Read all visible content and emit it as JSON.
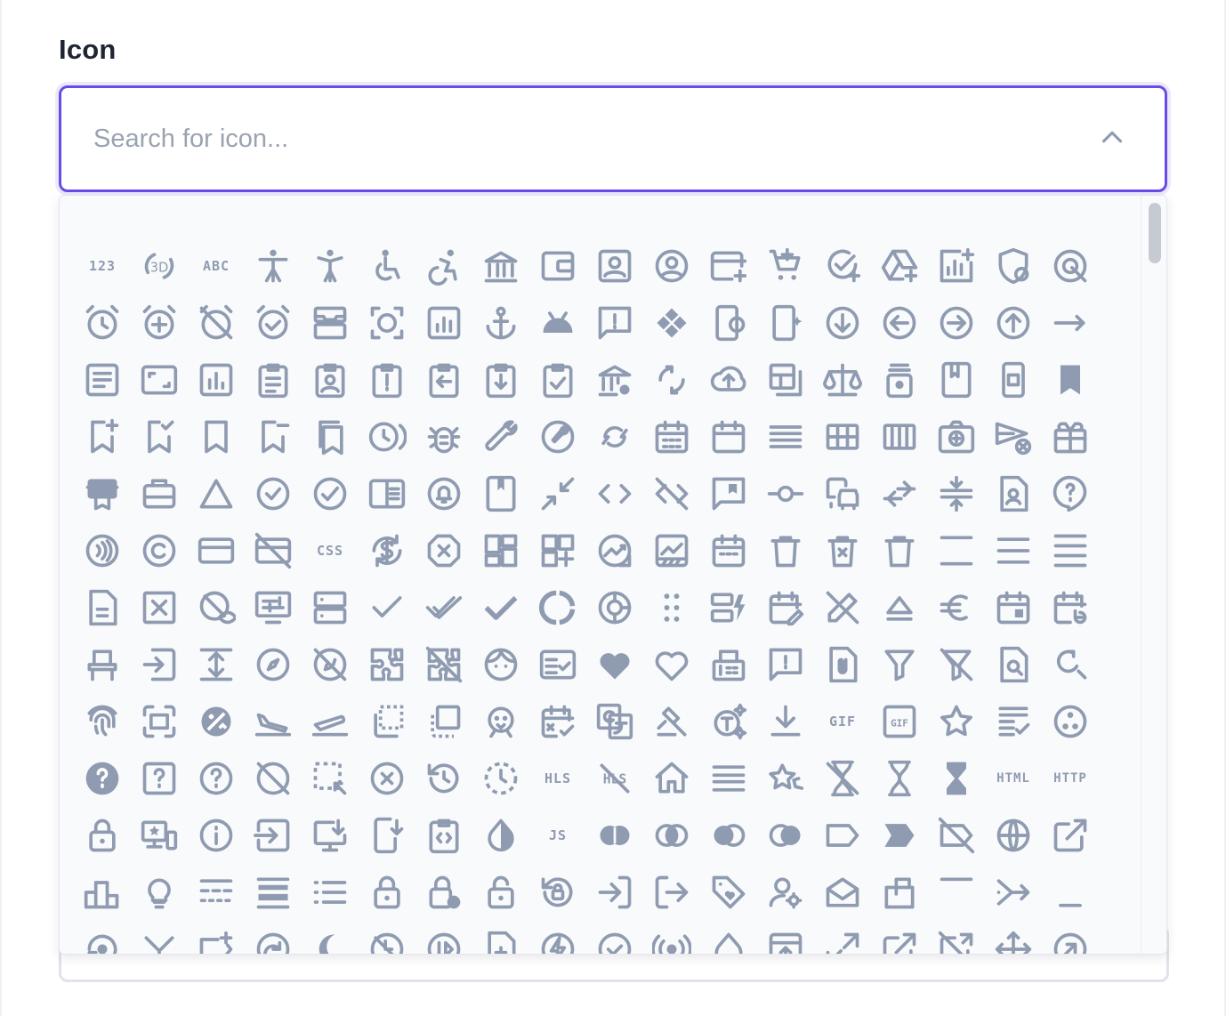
{
  "field": {
    "label": "Icon",
    "placeholder": "Search for icon...",
    "value": ""
  },
  "colors": {
    "accent": "#6a4be8",
    "icon": "#8f9bb0",
    "label": "#1f2533",
    "placeholder": "#9aa3b0"
  },
  "icons": [
    {
      "name": "123",
      "text": "123"
    },
    {
      "name": "3d-rotation",
      "text": ""
    },
    {
      "name": "abc",
      "text": "ABC"
    },
    {
      "name": "accessibility",
      "text": ""
    },
    {
      "name": "accessibility-new",
      "text": ""
    },
    {
      "name": "accessible",
      "text": ""
    },
    {
      "name": "accessible-forward",
      "text": ""
    },
    {
      "name": "account-balance",
      "text": ""
    },
    {
      "name": "account-balance-wallet",
      "text": ""
    },
    {
      "name": "account-box",
      "text": ""
    },
    {
      "name": "account-circle",
      "text": ""
    },
    {
      "name": "add-card",
      "text": ""
    },
    {
      "name": "add-shopping-cart",
      "text": ""
    },
    {
      "name": "add-task",
      "text": ""
    },
    {
      "name": "add-to-drive",
      "text": ""
    },
    {
      "name": "addchart",
      "text": ""
    },
    {
      "name": "admin-panel-settings",
      "text": ""
    },
    {
      "name": "ads-click",
      "text": ""
    },
    {
      "name": "alarm",
      "text": ""
    },
    {
      "name": "alarm-add",
      "text": ""
    },
    {
      "name": "alarm-off",
      "text": ""
    },
    {
      "name": "alarm-on",
      "text": ""
    },
    {
      "name": "all-inbox",
      "text": ""
    },
    {
      "name": "all-out",
      "text": ""
    },
    {
      "name": "analytics",
      "text": ""
    },
    {
      "name": "anchor",
      "text": ""
    },
    {
      "name": "android",
      "text": ""
    },
    {
      "name": "announcement",
      "text": ""
    },
    {
      "name": "api",
      "text": ""
    },
    {
      "name": "app-blocking",
      "text": ""
    },
    {
      "name": "app-shortcut",
      "text": ""
    },
    {
      "name": "arrow-circle-down",
      "text": ""
    },
    {
      "name": "arrow-circle-left",
      "text": ""
    },
    {
      "name": "arrow-circle-right",
      "text": ""
    },
    {
      "name": "arrow-circle-up",
      "text": ""
    },
    {
      "name": "arrow-right-alt",
      "text": ""
    },
    {
      "name": "article",
      "text": ""
    },
    {
      "name": "aspect-ratio",
      "text": ""
    },
    {
      "name": "assessment",
      "text": ""
    },
    {
      "name": "assignment",
      "text": ""
    },
    {
      "name": "assignment-ind",
      "text": ""
    },
    {
      "name": "assignment-late",
      "text": ""
    },
    {
      "name": "assignment-return",
      "text": ""
    },
    {
      "name": "assignment-returned",
      "text": ""
    },
    {
      "name": "assignment-turned-in",
      "text": ""
    },
    {
      "name": "assured-workload",
      "text": ""
    },
    {
      "name": "autorenew",
      "text": ""
    },
    {
      "name": "backup",
      "text": ""
    },
    {
      "name": "backup-table",
      "text": ""
    },
    {
      "name": "balance",
      "text": ""
    },
    {
      "name": "batch-prediction",
      "text": ""
    },
    {
      "name": "book",
      "text": ""
    },
    {
      "name": "book-online",
      "text": ""
    },
    {
      "name": "bookmark",
      "text": ""
    },
    {
      "name": "bookmark-add",
      "text": ""
    },
    {
      "name": "bookmark-added",
      "text": ""
    },
    {
      "name": "bookmark-border",
      "text": ""
    },
    {
      "name": "bookmark-remove",
      "text": ""
    },
    {
      "name": "bookmarks",
      "text": ""
    },
    {
      "name": "browse-gallery",
      "text": ""
    },
    {
      "name": "bug-report",
      "text": ""
    },
    {
      "name": "build",
      "text": ""
    },
    {
      "name": "build-circle",
      "text": ""
    },
    {
      "name": "cached",
      "text": ""
    },
    {
      "name": "calendar-month",
      "text": ""
    },
    {
      "name": "calendar-today",
      "text": ""
    },
    {
      "name": "calendar-view-day",
      "text": ""
    },
    {
      "name": "calendar-view-month",
      "text": ""
    },
    {
      "name": "calendar-view-week",
      "text": ""
    },
    {
      "name": "camera-enhance",
      "text": ""
    },
    {
      "name": "cancel-schedule-send",
      "text": ""
    },
    {
      "name": "card-giftcard",
      "text": ""
    },
    {
      "name": "card-membership",
      "text": ""
    },
    {
      "name": "card-travel",
      "text": ""
    },
    {
      "name": "change-history",
      "text": ""
    },
    {
      "name": "check-circle",
      "text": ""
    },
    {
      "name": "check-circle-outline",
      "text": ""
    },
    {
      "name": "chrome-reader-mode",
      "text": ""
    },
    {
      "name": "circle-notifications",
      "text": ""
    },
    {
      "name": "class",
      "text": ""
    },
    {
      "name": "close-fullscreen",
      "text": ""
    },
    {
      "name": "code",
      "text": ""
    },
    {
      "name": "code-off",
      "text": ""
    },
    {
      "name": "comment-bank",
      "text": ""
    },
    {
      "name": "commit",
      "text": ""
    },
    {
      "name": "commute",
      "text": ""
    },
    {
      "name": "compare-arrows",
      "text": ""
    },
    {
      "name": "compress",
      "text": ""
    },
    {
      "name": "contact-page",
      "text": ""
    },
    {
      "name": "contact-support",
      "text": ""
    },
    {
      "name": "contactless",
      "text": ""
    },
    {
      "name": "copyright",
      "text": ""
    },
    {
      "name": "credit-card",
      "text": ""
    },
    {
      "name": "credit-card-off",
      "text": ""
    },
    {
      "name": "css",
      "text": "CSS"
    },
    {
      "name": "currency-exchange",
      "text": ""
    },
    {
      "name": "dangerous",
      "text": ""
    },
    {
      "name": "dashboard",
      "text": ""
    },
    {
      "name": "dashboard-customize",
      "text": ""
    },
    {
      "name": "data-exploration",
      "text": ""
    },
    {
      "name": "data-thresholding",
      "text": ""
    },
    {
      "name": "date-range",
      "text": ""
    },
    {
      "name": "delete",
      "text": ""
    },
    {
      "name": "delete-forever",
      "text": ""
    },
    {
      "name": "delete-outline",
      "text": ""
    },
    {
      "name": "density-large",
      "text": ""
    },
    {
      "name": "density-medium",
      "text": ""
    },
    {
      "name": "density-small",
      "text": ""
    },
    {
      "name": "description",
      "text": ""
    },
    {
      "name": "disabled-by-default",
      "text": ""
    },
    {
      "name": "disabled-visible",
      "text": ""
    },
    {
      "name": "display-settings",
      "text": ""
    },
    {
      "name": "dns",
      "text": ""
    },
    {
      "name": "done",
      "text": ""
    },
    {
      "name": "done-all",
      "text": ""
    },
    {
      "name": "done-outline",
      "text": ""
    },
    {
      "name": "donut-large",
      "text": ""
    },
    {
      "name": "donut-small",
      "text": ""
    },
    {
      "name": "drag-indicator",
      "text": ""
    },
    {
      "name": "dynamic-form",
      "text": ""
    },
    {
      "name": "edit-calendar",
      "text": ""
    },
    {
      "name": "edit-off",
      "text": ""
    },
    {
      "name": "eject",
      "text": ""
    },
    {
      "name": "euro-symbol",
      "text": ""
    },
    {
      "name": "event",
      "text": ""
    },
    {
      "name": "event-repeat",
      "text": ""
    },
    {
      "name": "event-seat",
      "text": ""
    },
    {
      "name": "exit-to-app",
      "text": ""
    },
    {
      "name": "expand",
      "text": ""
    },
    {
      "name": "explore",
      "text": ""
    },
    {
      "name": "explore-off",
      "text": ""
    },
    {
      "name": "extension",
      "text": ""
    },
    {
      "name": "extension-off",
      "text": ""
    },
    {
      "name": "face",
      "text": ""
    },
    {
      "name": "fact-check",
      "text": ""
    },
    {
      "name": "favorite",
      "text": ""
    },
    {
      "name": "favorite-border",
      "text": ""
    },
    {
      "name": "fax",
      "text": ""
    },
    {
      "name": "feedback",
      "text": ""
    },
    {
      "name": "file-present",
      "text": ""
    },
    {
      "name": "filter-alt",
      "text": ""
    },
    {
      "name": "filter-alt-off",
      "text": ""
    },
    {
      "name": "find-in-page",
      "text": ""
    },
    {
      "name": "find-replace",
      "text": ""
    },
    {
      "name": "fingerprint",
      "text": ""
    },
    {
      "name": "fit-screen",
      "text": ""
    },
    {
      "name": "flaky",
      "text": ""
    },
    {
      "name": "flight-land",
      "text": ""
    },
    {
      "name": "flight-takeoff",
      "text": ""
    },
    {
      "name": "flip-to-back",
      "text": ""
    },
    {
      "name": "flip-to-front",
      "text": ""
    },
    {
      "name": "flutter-dash",
      "text": ""
    },
    {
      "name": "free-cancellation",
      "text": ""
    },
    {
      "name": "g-translate",
      "text": ""
    },
    {
      "name": "gavel",
      "text": ""
    },
    {
      "name": "generating-tokens",
      "text": ""
    },
    {
      "name": "get-app",
      "text": ""
    },
    {
      "name": "gif",
      "text": "GIF"
    },
    {
      "name": "gif-box",
      "text": ""
    },
    {
      "name": "grade",
      "text": ""
    },
    {
      "name": "grading",
      "text": ""
    },
    {
      "name": "group-work",
      "text": ""
    },
    {
      "name": "help",
      "text": ""
    },
    {
      "name": "help-center",
      "text": ""
    },
    {
      "name": "help-outline",
      "text": ""
    },
    {
      "name": "hide-source",
      "text": ""
    },
    {
      "name": "highlight-alt",
      "text": ""
    },
    {
      "name": "highlight-off",
      "text": ""
    },
    {
      "name": "history",
      "text": ""
    },
    {
      "name": "history-toggle-off",
      "text": ""
    },
    {
      "name": "hls",
      "text": "HLS"
    },
    {
      "name": "hls-off",
      "text": "HLS"
    },
    {
      "name": "home",
      "text": ""
    },
    {
      "name": "horizontal-split",
      "text": ""
    },
    {
      "name": "hotel-class",
      "text": ""
    },
    {
      "name": "hourglass-disabled",
      "text": ""
    },
    {
      "name": "hourglass-empty",
      "text": ""
    },
    {
      "name": "hourglass-full",
      "text": ""
    },
    {
      "name": "html",
      "text": "HTML"
    },
    {
      "name": "http",
      "text": "HTTP"
    },
    {
      "name": "https",
      "text": ""
    },
    {
      "name": "important-devices",
      "text": ""
    },
    {
      "name": "info",
      "text": ""
    },
    {
      "name": "input",
      "text": ""
    },
    {
      "name": "install-desktop",
      "text": ""
    },
    {
      "name": "install-mobile",
      "text": ""
    },
    {
      "name": "integration-instructions",
      "text": ""
    },
    {
      "name": "invert-colors",
      "text": ""
    },
    {
      "name": "javascript",
      "text": "JS"
    },
    {
      "name": "join-full",
      "text": ""
    },
    {
      "name": "join-inner",
      "text": ""
    },
    {
      "name": "join-left",
      "text": ""
    },
    {
      "name": "join-right",
      "text": ""
    },
    {
      "name": "label",
      "text": ""
    },
    {
      "name": "label-important",
      "text": ""
    },
    {
      "name": "label-off",
      "text": ""
    },
    {
      "name": "language",
      "text": ""
    },
    {
      "name": "launch",
      "text": ""
    },
    {
      "name": "leaderboard",
      "text": ""
    },
    {
      "name": "lightbulb",
      "text": ""
    },
    {
      "name": "line-style",
      "text": ""
    },
    {
      "name": "line-weight",
      "text": ""
    },
    {
      "name": "list",
      "text": ""
    },
    {
      "name": "lock",
      "text": ""
    },
    {
      "name": "lock-clock",
      "text": ""
    },
    {
      "name": "lock-open",
      "text": ""
    },
    {
      "name": "lock-reset",
      "text": ""
    },
    {
      "name": "login",
      "text": ""
    },
    {
      "name": "logout",
      "text": ""
    },
    {
      "name": "loyalty",
      "text": ""
    },
    {
      "name": "manage-accounts",
      "text": ""
    },
    {
      "name": "mark-as-unread",
      "text": ""
    },
    {
      "name": "markunread-mailbox",
      "text": ""
    },
    {
      "name": "maximize",
      "text": ""
    },
    {
      "name": "merge-type",
      "text": ""
    },
    {
      "name": "minimize",
      "text": ""
    },
    {
      "name": "model-training",
      "text": ""
    },
    {
      "name": "move-down",
      "text": ""
    },
    {
      "name": "new-label",
      "text": ""
    },
    {
      "name": "next-plan",
      "text": ""
    },
    {
      "name": "nightlight-round",
      "text": ""
    },
    {
      "name": "not-accessible",
      "text": ""
    },
    {
      "name": "not-started",
      "text": ""
    },
    {
      "name": "note-add",
      "text": ""
    },
    {
      "name": "offline-bolt",
      "text": ""
    },
    {
      "name": "offline-pin",
      "text": ""
    },
    {
      "name": "online-prediction",
      "text": ""
    },
    {
      "name": "opacity",
      "text": ""
    },
    {
      "name": "open-in-browser",
      "text": ""
    },
    {
      "name": "open-in-full",
      "text": ""
    },
    {
      "name": "open-in-new",
      "text": ""
    },
    {
      "name": "open-in-new-off",
      "text": ""
    },
    {
      "name": "open-with",
      "text": ""
    },
    {
      "name": "outbound",
      "text": ""
    }
  ]
}
